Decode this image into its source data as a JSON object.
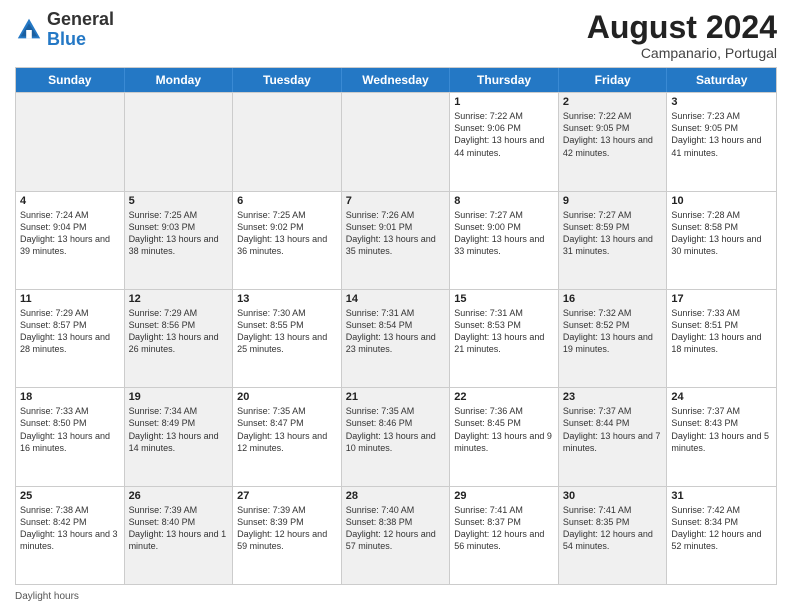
{
  "header": {
    "logo_line1": "General",
    "logo_line2": "Blue",
    "month_year": "August 2024",
    "location": "Campanario, Portugal"
  },
  "days_of_week": [
    "Sunday",
    "Monday",
    "Tuesday",
    "Wednesday",
    "Thursday",
    "Friday",
    "Saturday"
  ],
  "footer": {
    "daylight_label": "Daylight hours"
  },
  "weeks": [
    [
      {
        "day": "",
        "info": "",
        "shaded": true
      },
      {
        "day": "",
        "info": "",
        "shaded": true
      },
      {
        "day": "",
        "info": "",
        "shaded": true
      },
      {
        "day": "",
        "info": "",
        "shaded": true
      },
      {
        "day": "1",
        "info": "Sunrise: 7:22 AM\nSunset: 9:06 PM\nDaylight: 13 hours and 44 minutes.",
        "shaded": false
      },
      {
        "day": "2",
        "info": "Sunrise: 7:22 AM\nSunset: 9:05 PM\nDaylight: 13 hours and 42 minutes.",
        "shaded": true
      },
      {
        "day": "3",
        "info": "Sunrise: 7:23 AM\nSunset: 9:05 PM\nDaylight: 13 hours and 41 minutes.",
        "shaded": false
      }
    ],
    [
      {
        "day": "4",
        "info": "Sunrise: 7:24 AM\nSunset: 9:04 PM\nDaylight: 13 hours and 39 minutes.",
        "shaded": false
      },
      {
        "day": "5",
        "info": "Sunrise: 7:25 AM\nSunset: 9:03 PM\nDaylight: 13 hours and 38 minutes.",
        "shaded": true
      },
      {
        "day": "6",
        "info": "Sunrise: 7:25 AM\nSunset: 9:02 PM\nDaylight: 13 hours and 36 minutes.",
        "shaded": false
      },
      {
        "day": "7",
        "info": "Sunrise: 7:26 AM\nSunset: 9:01 PM\nDaylight: 13 hours and 35 minutes.",
        "shaded": true
      },
      {
        "day": "8",
        "info": "Sunrise: 7:27 AM\nSunset: 9:00 PM\nDaylight: 13 hours and 33 minutes.",
        "shaded": false
      },
      {
        "day": "9",
        "info": "Sunrise: 7:27 AM\nSunset: 8:59 PM\nDaylight: 13 hours and 31 minutes.",
        "shaded": true
      },
      {
        "day": "10",
        "info": "Sunrise: 7:28 AM\nSunset: 8:58 PM\nDaylight: 13 hours and 30 minutes.",
        "shaded": false
      }
    ],
    [
      {
        "day": "11",
        "info": "Sunrise: 7:29 AM\nSunset: 8:57 PM\nDaylight: 13 hours and 28 minutes.",
        "shaded": false
      },
      {
        "day": "12",
        "info": "Sunrise: 7:29 AM\nSunset: 8:56 PM\nDaylight: 13 hours and 26 minutes.",
        "shaded": true
      },
      {
        "day": "13",
        "info": "Sunrise: 7:30 AM\nSunset: 8:55 PM\nDaylight: 13 hours and 25 minutes.",
        "shaded": false
      },
      {
        "day": "14",
        "info": "Sunrise: 7:31 AM\nSunset: 8:54 PM\nDaylight: 13 hours and 23 minutes.",
        "shaded": true
      },
      {
        "day": "15",
        "info": "Sunrise: 7:31 AM\nSunset: 8:53 PM\nDaylight: 13 hours and 21 minutes.",
        "shaded": false
      },
      {
        "day": "16",
        "info": "Sunrise: 7:32 AM\nSunset: 8:52 PM\nDaylight: 13 hours and 19 minutes.",
        "shaded": true
      },
      {
        "day": "17",
        "info": "Sunrise: 7:33 AM\nSunset: 8:51 PM\nDaylight: 13 hours and 18 minutes.",
        "shaded": false
      }
    ],
    [
      {
        "day": "18",
        "info": "Sunrise: 7:33 AM\nSunset: 8:50 PM\nDaylight: 13 hours and 16 minutes.",
        "shaded": false
      },
      {
        "day": "19",
        "info": "Sunrise: 7:34 AM\nSunset: 8:49 PM\nDaylight: 13 hours and 14 minutes.",
        "shaded": true
      },
      {
        "day": "20",
        "info": "Sunrise: 7:35 AM\nSunset: 8:47 PM\nDaylight: 13 hours and 12 minutes.",
        "shaded": false
      },
      {
        "day": "21",
        "info": "Sunrise: 7:35 AM\nSunset: 8:46 PM\nDaylight: 13 hours and 10 minutes.",
        "shaded": true
      },
      {
        "day": "22",
        "info": "Sunrise: 7:36 AM\nSunset: 8:45 PM\nDaylight: 13 hours and 9 minutes.",
        "shaded": false
      },
      {
        "day": "23",
        "info": "Sunrise: 7:37 AM\nSunset: 8:44 PM\nDaylight: 13 hours and 7 minutes.",
        "shaded": true
      },
      {
        "day": "24",
        "info": "Sunrise: 7:37 AM\nSunset: 8:43 PM\nDaylight: 13 hours and 5 minutes.",
        "shaded": false
      }
    ],
    [
      {
        "day": "25",
        "info": "Sunrise: 7:38 AM\nSunset: 8:42 PM\nDaylight: 13 hours and 3 minutes.",
        "shaded": false
      },
      {
        "day": "26",
        "info": "Sunrise: 7:39 AM\nSunset: 8:40 PM\nDaylight: 13 hours and 1 minute.",
        "shaded": true
      },
      {
        "day": "27",
        "info": "Sunrise: 7:39 AM\nSunset: 8:39 PM\nDaylight: 12 hours and 59 minutes.",
        "shaded": false
      },
      {
        "day": "28",
        "info": "Sunrise: 7:40 AM\nSunset: 8:38 PM\nDaylight: 12 hours and 57 minutes.",
        "shaded": true
      },
      {
        "day": "29",
        "info": "Sunrise: 7:41 AM\nSunset: 8:37 PM\nDaylight: 12 hours and 56 minutes.",
        "shaded": false
      },
      {
        "day": "30",
        "info": "Sunrise: 7:41 AM\nSunset: 8:35 PM\nDaylight: 12 hours and 54 minutes.",
        "shaded": true
      },
      {
        "day": "31",
        "info": "Sunrise: 7:42 AM\nSunset: 8:34 PM\nDaylight: 12 hours and 52 minutes.",
        "shaded": false
      }
    ]
  ]
}
